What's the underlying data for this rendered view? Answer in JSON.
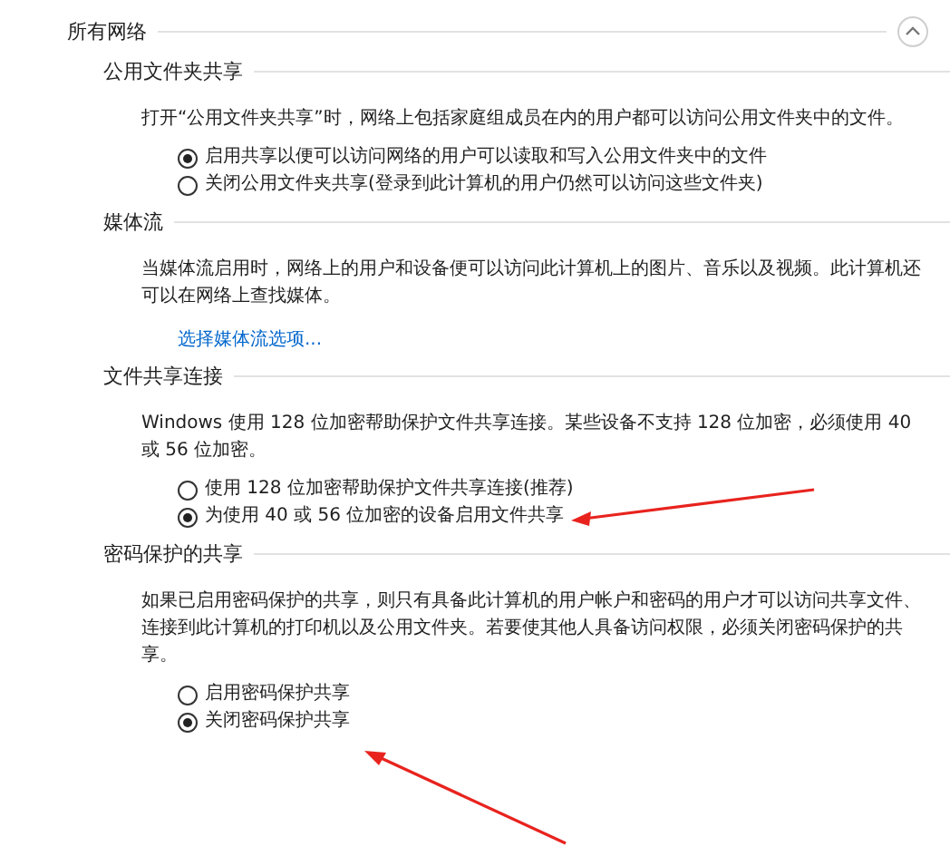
{
  "group": {
    "title": "所有网络",
    "expanded": true
  },
  "sections": [
    {
      "title": "公用文件夹共享",
      "description": "打开“公用文件夹共享”时，网络上包括家庭组成员在内的用户都可以访问公用文件夹中的文件。",
      "options": [
        {
          "label": "启用共享以便可以访问网络的用户可以读取和写入公用文件夹中的文件",
          "selected": true
        },
        {
          "label": "关闭公用文件夹共享(登录到此计算机的用户仍然可以访问这些文件夹)",
          "selected": false
        }
      ]
    },
    {
      "title": "媒体流",
      "description": "当媒体流启用时，网络上的用户和设备便可以访问此计算机上的图片、音乐以及视频。此计算机还可以在网络上查找媒体。",
      "link": "选择媒体流选项..."
    },
    {
      "title": "文件共享连接",
      "description": "Windows 使用 128 位加密帮助保护文件共享连接。某些设备不支持 128 位加密，必须使用 40 或 56 位加密。",
      "options": [
        {
          "label": "使用 128 位加密帮助保护文件共享连接(推荐)",
          "selected": false
        },
        {
          "label": "为使用 40 或 56 位加密的设备启用文件共享",
          "selected": true
        }
      ]
    },
    {
      "title": "密码保护的共享",
      "description": "如果已启用密码保护的共享，则只有具备此计算机的用户帐户和密码的用户才可以访问共享文件、连接到此计算机的打印机以及公用文件夹。若要使其他人具备访问权限，必须关闭密码保护的共享。",
      "options": [
        {
          "label": "启用密码保护共享",
          "selected": false
        },
        {
          "label": "关闭密码保护共享",
          "selected": true
        }
      ]
    }
  ]
}
